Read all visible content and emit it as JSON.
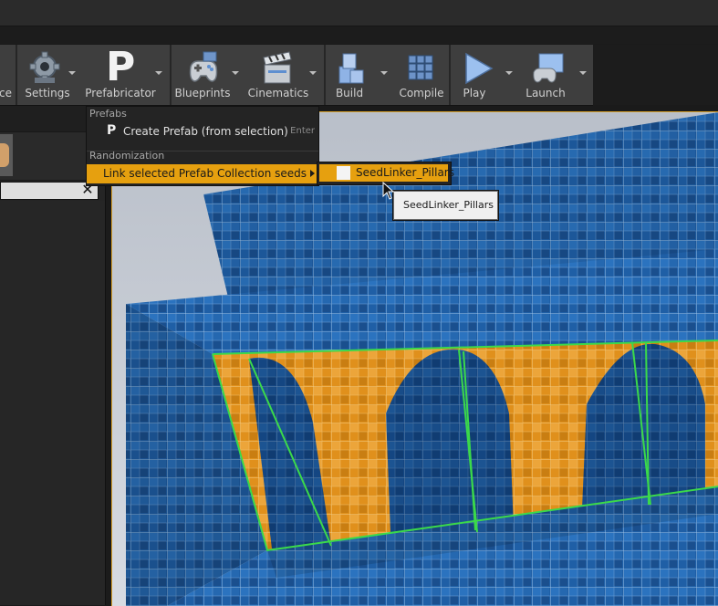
{
  "toolbar": {
    "buttons": [
      {
        "label": "ce",
        "icon": "source-control-icon"
      },
      {
        "label": "Settings",
        "icon": "gear-icon"
      },
      {
        "label": "Prefabricator",
        "icon": "prefab-p-icon",
        "glyph": "P"
      },
      {
        "label": "Blueprints",
        "icon": "gamepad-icon"
      },
      {
        "label": "Cinematics",
        "icon": "clapperboard-icon"
      },
      {
        "label": "Build",
        "icon": "build-blocks-icon"
      },
      {
        "label": "Compile",
        "icon": "compile-cubes-icon"
      },
      {
        "label": "Play",
        "icon": "play-icon"
      },
      {
        "label": "Launch",
        "icon": "launch-monitor-icon"
      }
    ]
  },
  "menu": {
    "section_prefabs": "Prefabs",
    "create_prefab": {
      "label": "Create Prefab (from selection)",
      "shortcut": "Enter",
      "icon_glyph": "P"
    },
    "section_randomization": "Randomization",
    "link_seeds": {
      "label": "Link selected Prefab Collection seeds"
    }
  },
  "submenu": {
    "item_label": "SeedLinker_Pillars"
  },
  "tooltip": {
    "text": "SeedLinker_Pillars"
  },
  "left_panel": {
    "close_glyph": "✕"
  },
  "colors": {
    "accent": "#e6a00f",
    "selection_outline": "#3bd94a",
    "tile_blue": "#1f5fa6",
    "tile_orange": "#e0901c"
  }
}
